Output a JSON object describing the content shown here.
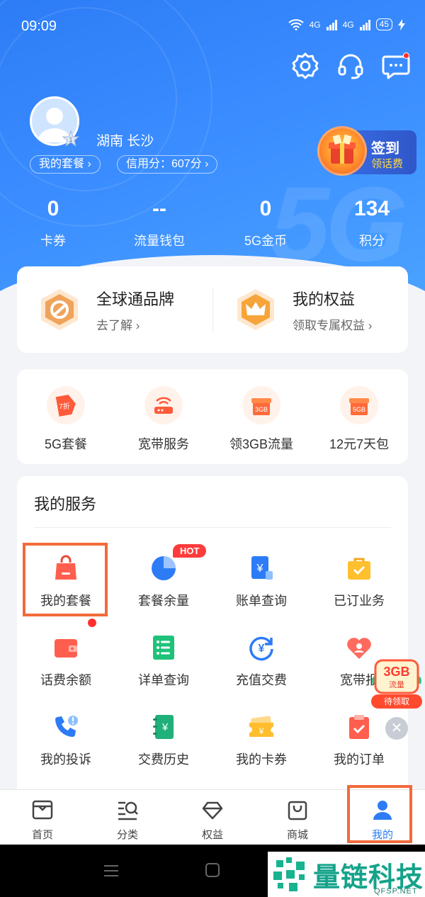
{
  "status_bar": {
    "time": "09:09",
    "network_1": "4G",
    "network_2": "4G",
    "battery": "45"
  },
  "header": {
    "icons": [
      "gear-icon",
      "headset-icon",
      "message-icon"
    ],
    "location": "湖南  长沙",
    "avatar_level": "1",
    "pill_plan": "我的套餐",
    "pill_credit": "信用分：607分",
    "signin_title": "签到",
    "signin_sub": "领话费"
  },
  "stats": [
    {
      "value": "0",
      "label": "卡券"
    },
    {
      "value": "--",
      "label": "流量钱包"
    },
    {
      "value": "0",
      "label": "5G金币"
    },
    {
      "value": "134",
      "label": "积分"
    }
  ],
  "brand_cards": [
    {
      "title": "全球通品牌",
      "subtitle": "去了解 ›",
      "icon": "globe-brand-icon"
    },
    {
      "title": "我的权益",
      "subtitle": "领取专属权益 ›",
      "icon": "crown-icon"
    }
  ],
  "quick_items": [
    {
      "label": "5G套餐",
      "badge": "7折"
    },
    {
      "label": "宽带服务",
      "badge": ""
    },
    {
      "label": "领3GB流量",
      "badge": "3GB"
    },
    {
      "label": "12元7天包",
      "badge": "5GB"
    }
  ],
  "services": {
    "title": "我的服务",
    "hot_badge": "HOT",
    "items": [
      {
        "label": "我的套餐",
        "icon": "shopping-bag-icon"
      },
      {
        "label": "套餐余量",
        "icon": "pie-chart-icon"
      },
      {
        "label": "账单查询",
        "icon": "bill-icon"
      },
      {
        "label": "已订业务",
        "icon": "briefcase-icon"
      },
      {
        "label": "话费余额",
        "icon": "wallet-icon"
      },
      {
        "label": "详单查询",
        "icon": "list-icon"
      },
      {
        "label": "充值交费",
        "icon": "recharge-icon"
      },
      {
        "label": "宽带报",
        "icon": "heart-icon"
      },
      {
        "label": "我的投诉",
        "icon": "phone-complaint-icon"
      },
      {
        "label": "交费历史",
        "icon": "history-icon"
      },
      {
        "label": "我的卡券",
        "icon": "ticket-icon"
      },
      {
        "label": "我的订单",
        "icon": "order-icon"
      }
    ]
  },
  "float_promo": {
    "amount": "3GB",
    "unit": "流量",
    "action": "待领取"
  },
  "tabbar": [
    {
      "label": "首页",
      "icon": "home-icon"
    },
    {
      "label": "分类",
      "icon": "category-icon"
    },
    {
      "label": "权益",
      "icon": "diamond-icon"
    },
    {
      "label": "商城",
      "icon": "shop-bag-icon"
    },
    {
      "label": "我的",
      "icon": "user-icon",
      "active": true
    }
  ],
  "watermark": {
    "text": "量链科技",
    "url": "QFSP.NET"
  },
  "colors": {
    "primary": "#2d7cf6",
    "accent_orange": "#f26a3b",
    "highlight_red": "#ff3b3b"
  }
}
